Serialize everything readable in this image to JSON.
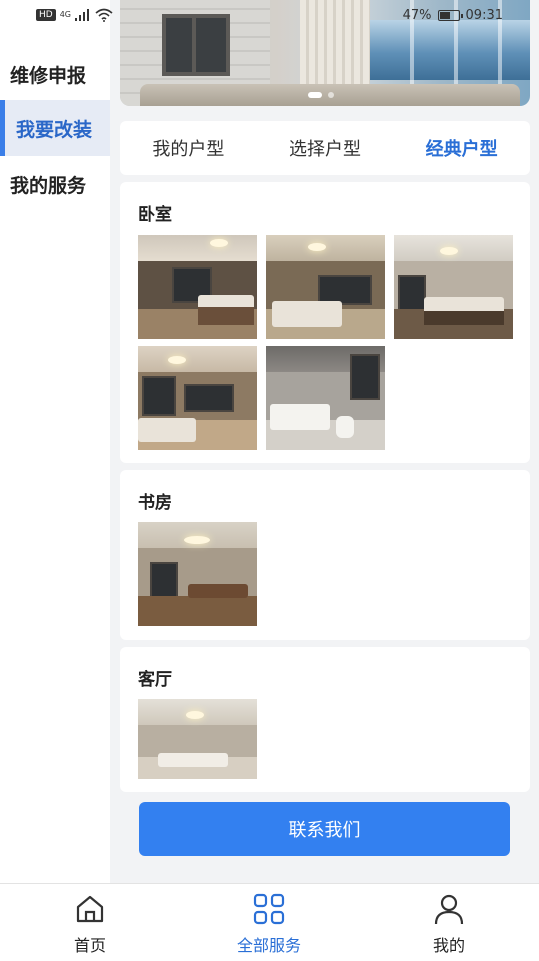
{
  "status_bar": {
    "hd": "HD",
    "network": "4G",
    "battery": "47%",
    "time": "09:31"
  },
  "sidebar": {
    "items": [
      {
        "label": "维修申报",
        "active": false
      },
      {
        "label": "我要改装",
        "active": true
      },
      {
        "label": "我的服务",
        "active": false
      }
    ]
  },
  "tabs": [
    {
      "label": "我的户型",
      "active": false
    },
    {
      "label": "选择户型",
      "active": false
    },
    {
      "label": "经典户型",
      "active": true
    }
  ],
  "categories": [
    {
      "title": "卧室",
      "thumb_count": 5
    },
    {
      "title": "书房",
      "thumb_count": 1
    },
    {
      "title": "客厅",
      "thumb_count": 1
    }
  ],
  "contact_button": "联系我们",
  "bottom_nav": [
    {
      "label": "首页",
      "icon": "home-icon",
      "active": false
    },
    {
      "label": "全部服务",
      "icon": "grid-icon",
      "active": true
    },
    {
      "label": "我的",
      "icon": "user-icon",
      "active": false
    }
  ],
  "colors": {
    "accent": "#3380f0",
    "active_text": "#2a6fd6",
    "sidebar_active_bg": "#e6ebf5",
    "page_bg": "#f2f3f5"
  }
}
